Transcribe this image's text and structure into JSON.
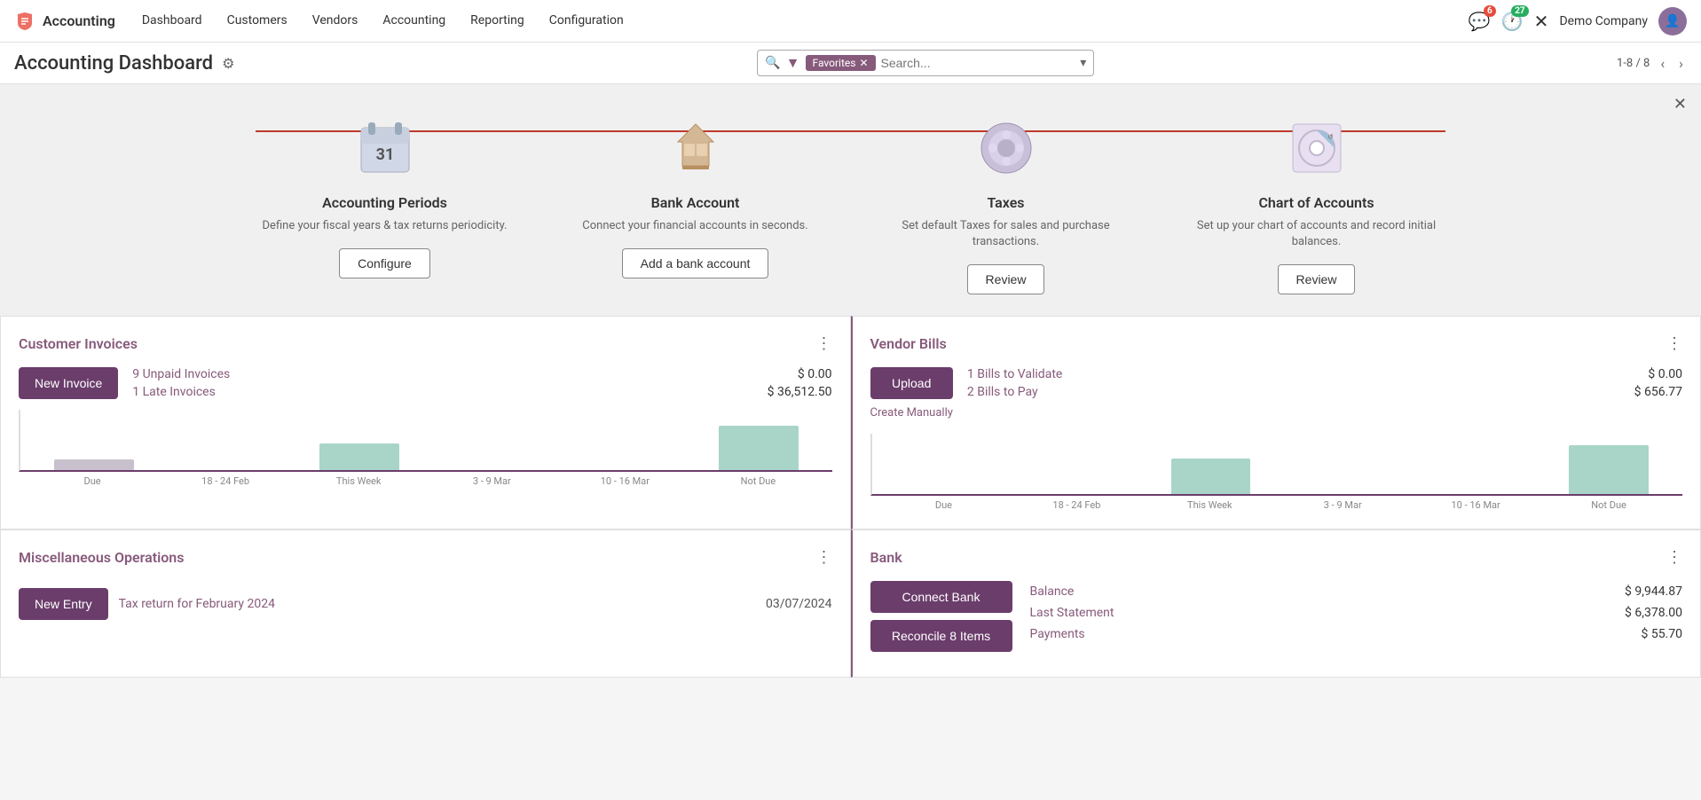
{
  "app": {
    "brand": "Accounting",
    "brand_icon": "✕"
  },
  "nav": {
    "links": [
      "Dashboard",
      "Customers",
      "Vendors",
      "Accounting",
      "Reporting",
      "Configuration"
    ],
    "notifications_count": "6",
    "messages_count": "27",
    "company": "Demo Company"
  },
  "header": {
    "title": "Accounting Dashboard",
    "gear_label": "⚙",
    "search_placeholder": "Search...",
    "filter_label": "Favorites",
    "pagination": "1-8 / 8"
  },
  "onboarding": {
    "close_label": "✕",
    "steps": [
      {
        "title": "Accounting Periods",
        "desc": "Define your fiscal years & tax returns periodicity.",
        "btn_label": "Configure",
        "icon": "📅"
      },
      {
        "title": "Bank Account",
        "desc": "Connect your financial accounts in seconds.",
        "btn_label": "Add a bank account",
        "icon": "🧩"
      },
      {
        "title": "Taxes",
        "desc": "Set default Taxes for sales and purchase transactions.",
        "btn_label": "Review",
        "icon": "⚙️"
      },
      {
        "title": "Chart of Accounts",
        "desc": "Set up your chart of accounts and record initial balances.",
        "btn_label": "Review",
        "icon": "📊"
      }
    ]
  },
  "customer_invoices": {
    "title": "Customer Invoices",
    "new_invoice_label": "New Invoice",
    "unpaid_label": "9 Unpaid Invoices",
    "unpaid_amount": "$ 0.00",
    "late_label": "1 Late Invoices",
    "late_amount": "$ 36,512.50",
    "chart": {
      "labels": [
        "Due",
        "18 - 24 Feb",
        "This Week",
        "3 - 9 Mar",
        "10 - 16 Mar",
        "Not Due"
      ],
      "values": [
        8,
        0,
        25,
        0,
        0,
        45
      ]
    }
  },
  "vendor_bills": {
    "title": "Vendor Bills",
    "upload_label": "Upload",
    "validate_label": "1 Bills to Validate",
    "validate_amount": "$ 0.00",
    "pay_label": "2 Bills to Pay",
    "pay_amount": "$ 656.77",
    "create_manually_label": "Create Manually",
    "chart": {
      "labels": [
        "Due",
        "18 - 24 Feb",
        "This Week",
        "3 - 9 Mar",
        "10 - 16 Mar",
        "Not Due"
      ],
      "values": [
        0,
        0,
        35,
        0,
        0,
        55
      ]
    }
  },
  "misc_operations": {
    "title": "Miscellaneous Operations",
    "new_entry_label": "New Entry",
    "tax_return_label": "Tax return for February 2024",
    "tax_return_date": "03/07/2024"
  },
  "bank": {
    "title": "Bank",
    "connect_bank_label": "Connect Bank",
    "reconcile_label": "Reconcile 8 Items",
    "balance_label": "Balance",
    "balance_amount": "$ 9,944.87",
    "last_statement_label": "Last Statement",
    "last_statement_amount": "$ 6,378.00",
    "payments_label": "Payments",
    "payments_amount": "$ 55.70"
  }
}
